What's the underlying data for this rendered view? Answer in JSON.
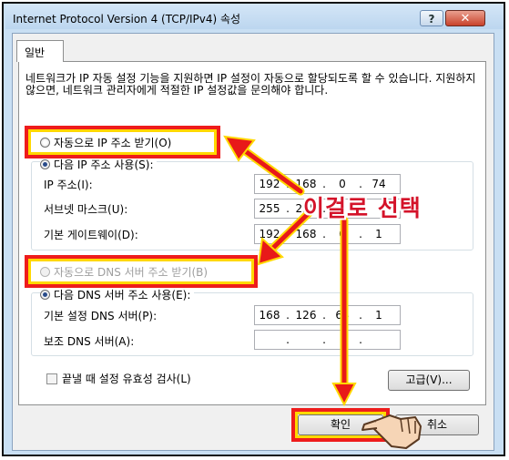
{
  "window": {
    "title": "Internet Protocol Version 4 (TCP/IPv4) 속성",
    "help_label": "?",
    "close_label": "✕"
  },
  "tabs": [
    {
      "label": "일반"
    }
  ],
  "description": "네트워크가 IP 자동 설정 기능을 지원하면 IP 설정이 자동으로 할당되도록 할 수 있습니다. 지원하지 않으면, 네트워크 관리자에게 적절한 IP 설정값을 문의해야 합니다.",
  "ip_section": {
    "auto_radio": "자동으로 IP 주소 받기(O)",
    "manual_radio": "다음 IP 주소 사용(S):",
    "fields": [
      {
        "label": "IP 주소(I):",
        "octets": [
          "192",
          "168",
          "0",
          "74"
        ]
      },
      {
        "label": "서브넷 마스크(U):",
        "octets": [
          "255",
          "255",
          "",
          ""
        ]
      },
      {
        "label": "기본 게이트웨이(D):",
        "octets": [
          "192",
          "168",
          "0",
          "1"
        ]
      }
    ]
  },
  "dns_section": {
    "auto_radio": "자동으로 DNS 서버 주소 받기(B)",
    "manual_radio": "다음 DNS 서버 주소 사용(E):",
    "fields": [
      {
        "label": "기본 설정 DNS 서버(P):",
        "octets": [
          "168",
          "126",
          "63",
          "1"
        ]
      },
      {
        "label": "보조 DNS 서버(A):",
        "octets": [
          "",
          "",
          "",
          ""
        ]
      }
    ]
  },
  "validate_checkbox": "끝낼 때 설정 유효성 검사(L)",
  "buttons": {
    "advanced": "고급(V)...",
    "ok": "확인",
    "cancel": "취소"
  },
  "annotation": {
    "callout": "이걸로 선택"
  },
  "colors": {
    "highlight_red": "#ee1c1c",
    "highlight_yellow": "#ffd800",
    "callout_text": "#d4132a"
  }
}
